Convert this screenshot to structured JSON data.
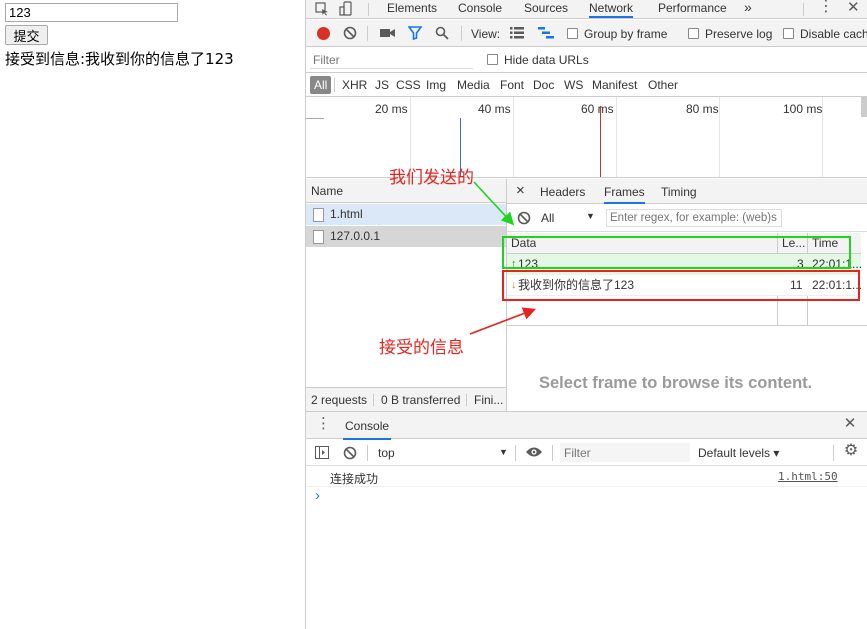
{
  "page": {
    "input_value": "123",
    "submit_label": "提交",
    "received_text": "接受到信息:我收到你的信息了123"
  },
  "devtools": {
    "tabs": [
      "Elements",
      "Console",
      "Sources",
      "Network",
      "Performance",
      "»"
    ],
    "active_tab": "Network",
    "toolbar": {
      "view_label": "View:",
      "group_by_frame": "Group by frame",
      "preserve_log": "Preserve log",
      "disable_cache": "Disable cach"
    },
    "filter": {
      "placeholder": "Filter",
      "hide_data_urls": "Hide data URLs"
    },
    "types": [
      "All",
      "XHR",
      "JS",
      "CSS",
      "Img",
      "Media",
      "Font",
      "Doc",
      "WS",
      "Manifest",
      "Other"
    ],
    "timeline_ticks": [
      "20 ms",
      "40 ms",
      "60 ms",
      "80 ms",
      "100 ms"
    ],
    "requests": {
      "header": "Name",
      "items": [
        "1.html",
        "127.0.0.1"
      ],
      "status": [
        "2 requests",
        "0 B transferred",
        "Fini..."
      ]
    },
    "detail": {
      "close": "×",
      "tabs": [
        "Headers",
        "Frames",
        "Timing"
      ],
      "active_tab": "Frames",
      "frame_filter_option": "All",
      "regex_placeholder": "Enter regex, for example: (web)s",
      "columns": [
        "Data",
        "Le...",
        "Time"
      ],
      "frames": [
        {
          "arrow": "↑",
          "data": "123",
          "length": "3",
          "time": "22:01:1...",
          "kind": "sent"
        },
        {
          "arrow": "↓",
          "data": "我收到你的信息了123",
          "length": "11",
          "time": "22:01:1...",
          "kind": "received"
        }
      ],
      "empty_hint": "Select frame to browse its content."
    },
    "drawer": {
      "tab": "Console",
      "context": "top",
      "filter_placeholder": "Filter",
      "levels": "Default levels ▾",
      "log": {
        "message": "连接成功",
        "source": "1.html:50"
      },
      "prompt": "›"
    }
  },
  "annotations": {
    "sent": "我们发送的",
    "received": "接受的信息"
  },
  "colors": {
    "annotation": "#e8231b",
    "sent_box": "#1fd31f",
    "received_box": "#e8231b",
    "sent_row_bg": "#e5f7e5",
    "accent": "#1a73e8",
    "record": "#d93025"
  }
}
